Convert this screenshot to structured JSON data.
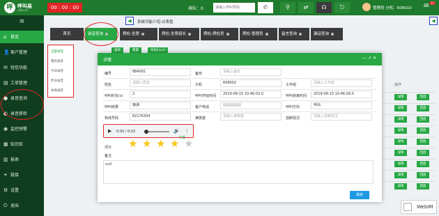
{
  "topbar": {
    "logo_text": "呼叫易",
    "logo_sub": "HUJIAOYI",
    "timer": "00 : 00 : 00",
    "queue": "排队：0",
    "search_placeholder": "请输入呼叫号码",
    "user": "管理员  分机：608010"
  },
  "sidebar": {
    "items": [
      {
        "label": "首页",
        "icon": "home"
      },
      {
        "label": "客户管理",
        "icon": "user"
      },
      {
        "label": "短信功能",
        "icon": "sms"
      },
      {
        "label": "工单管理",
        "icon": "ticket"
      },
      {
        "label": "录音查询",
        "icon": "record"
      },
      {
        "label": "录音质检",
        "icon": "quality"
      },
      {
        "label": "监控预警",
        "icon": "monitor"
      },
      {
        "label": "知识库",
        "icon": "book"
      },
      {
        "label": "报表",
        "icon": "chart"
      },
      {
        "label": "链接",
        "icon": "link"
      },
      {
        "label": "设置",
        "icon": "gear"
      },
      {
        "label": "退出",
        "icon": "power"
      }
    ]
  },
  "notice": "系统功能介绍-仪表盘",
  "tabs": [
    "首页",
    "录音查询",
    "质检-坐席",
    "质检-坐席组长",
    "质检-质检员",
    "质检-管理员",
    "留言查询",
    "漏话查询"
  ],
  "subnav": [
    "全部录音",
    "我的录音",
    "今日录音",
    "昨日录音",
    "本周录音"
  ],
  "subtabs": [
    "查询",
    "重置",
    "导出Excel"
  ],
  "list": {
    "op_header": "操作",
    "btn_detail": "详情",
    "btn_play": "回放",
    "rows": 9
  },
  "modal": {
    "title": "详情",
    "controls": "— ↗ ✕",
    "fields": {
      "bianhao_label": "编号",
      "bianhao_value": "884091",
      "yewu_label": "备份",
      "yewu_placeholder": "请输入备份",
      "xingming_label": "姓名",
      "xingming_placeholder": "请输入姓名",
      "fenji_label": "分机",
      "fenji_value": "608002",
      "gonghao_label": "工作组",
      "gonghao_placeholder": "请输入工作组",
      "shichang_label": "呼叫时长(s)",
      "shichang_value": "2",
      "kaishi_label": "呼叫开始时间",
      "kaishi_value": "2019-08-15 10:46:03.0",
      "jieshu_label": "呼叫结束时间",
      "jieshu_value": "2019-08-15 10:46:09.0",
      "jieguo_label": "呼叫结果",
      "jieguo_value": "接通",
      "kehu_label": "客户电话",
      "fangxiang_label": "呼叫方向",
      "fangxiang_value": "呼出",
      "rexian_label": "热线号码",
      "rexian_value": "82176304",
      "manyi_label": "满意度",
      "manyi_placeholder": "请输入满意度",
      "guaduan_label": "挂断情况",
      "guaduan_placeholder": "请输入挂断情况"
    },
    "audio_time": "0:00 / 0:02",
    "download": "下载",
    "rating_label": "评分",
    "rating": 4,
    "rating_max": 5,
    "notes_label": "备注",
    "notes_value": "null",
    "save": "保存"
  },
  "webim": "WebIM"
}
